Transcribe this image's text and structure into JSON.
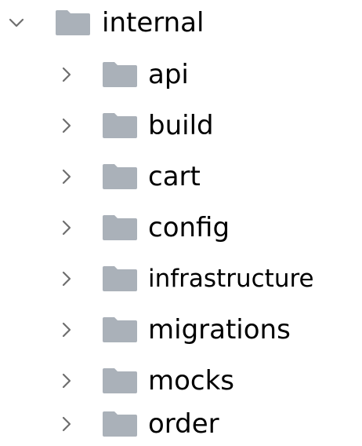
{
  "tree": {
    "root": {
      "label": "internal",
      "expanded": true,
      "icon": "folder-icon",
      "chevron": "chevron-down-icon"
    },
    "children": [
      {
        "label": "api",
        "expanded": false,
        "icon": "folder-icon",
        "chevron": "chevron-right-icon"
      },
      {
        "label": "build",
        "expanded": false,
        "icon": "folder-icon",
        "chevron": "chevron-right-icon"
      },
      {
        "label": "cart",
        "expanded": false,
        "icon": "folder-icon",
        "chevron": "chevron-right-icon"
      },
      {
        "label": "config",
        "expanded": false,
        "icon": "folder-icon",
        "chevron": "chevron-right-icon"
      },
      {
        "label": "infrastructure",
        "expanded": false,
        "icon": "folder-icon",
        "chevron": "chevron-right-icon"
      },
      {
        "label": "migrations",
        "expanded": false,
        "icon": "folder-icon",
        "chevron": "chevron-right-icon"
      },
      {
        "label": "mocks",
        "expanded": false,
        "icon": "folder-icon",
        "chevron": "chevron-right-icon"
      },
      {
        "label": "order",
        "expanded": false,
        "icon": "folder-icon",
        "chevron": "chevron-right-icon"
      }
    ]
  },
  "colors": {
    "folder": "#aab1b9",
    "chevron": "#6e6e6e",
    "text": "#000000"
  }
}
